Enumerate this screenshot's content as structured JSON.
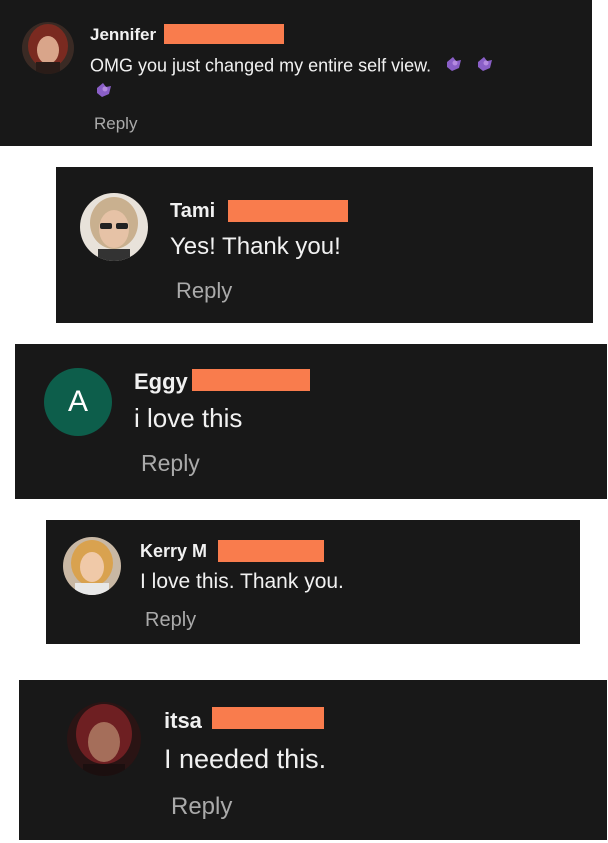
{
  "comments": [
    {
      "name": "Jennifer",
      "text": "OMG you just changed my entire self view.",
      "reply_label": "Reply",
      "emoji_icon": "purple-heart-hands-emoji"
    },
    {
      "name": "Tami",
      "text": "Yes! Thank you!",
      "reply_label": "Reply"
    },
    {
      "name": "Eggy",
      "text": "i love this",
      "reply_label": "Reply",
      "avatar_initial": "A"
    },
    {
      "name": "Kerry M",
      "text": "I love this. Thank you.",
      "reply_label": "Reply"
    },
    {
      "name": "itsa",
      "text": "I needed this.",
      "reply_label": "Reply"
    }
  ],
  "colors": {
    "card_bg": "#181818",
    "redaction": "#f97c4d",
    "text": "#f1f1f1",
    "muted": "#aaaaaa",
    "avatar_green": "#0d5e4b"
  }
}
